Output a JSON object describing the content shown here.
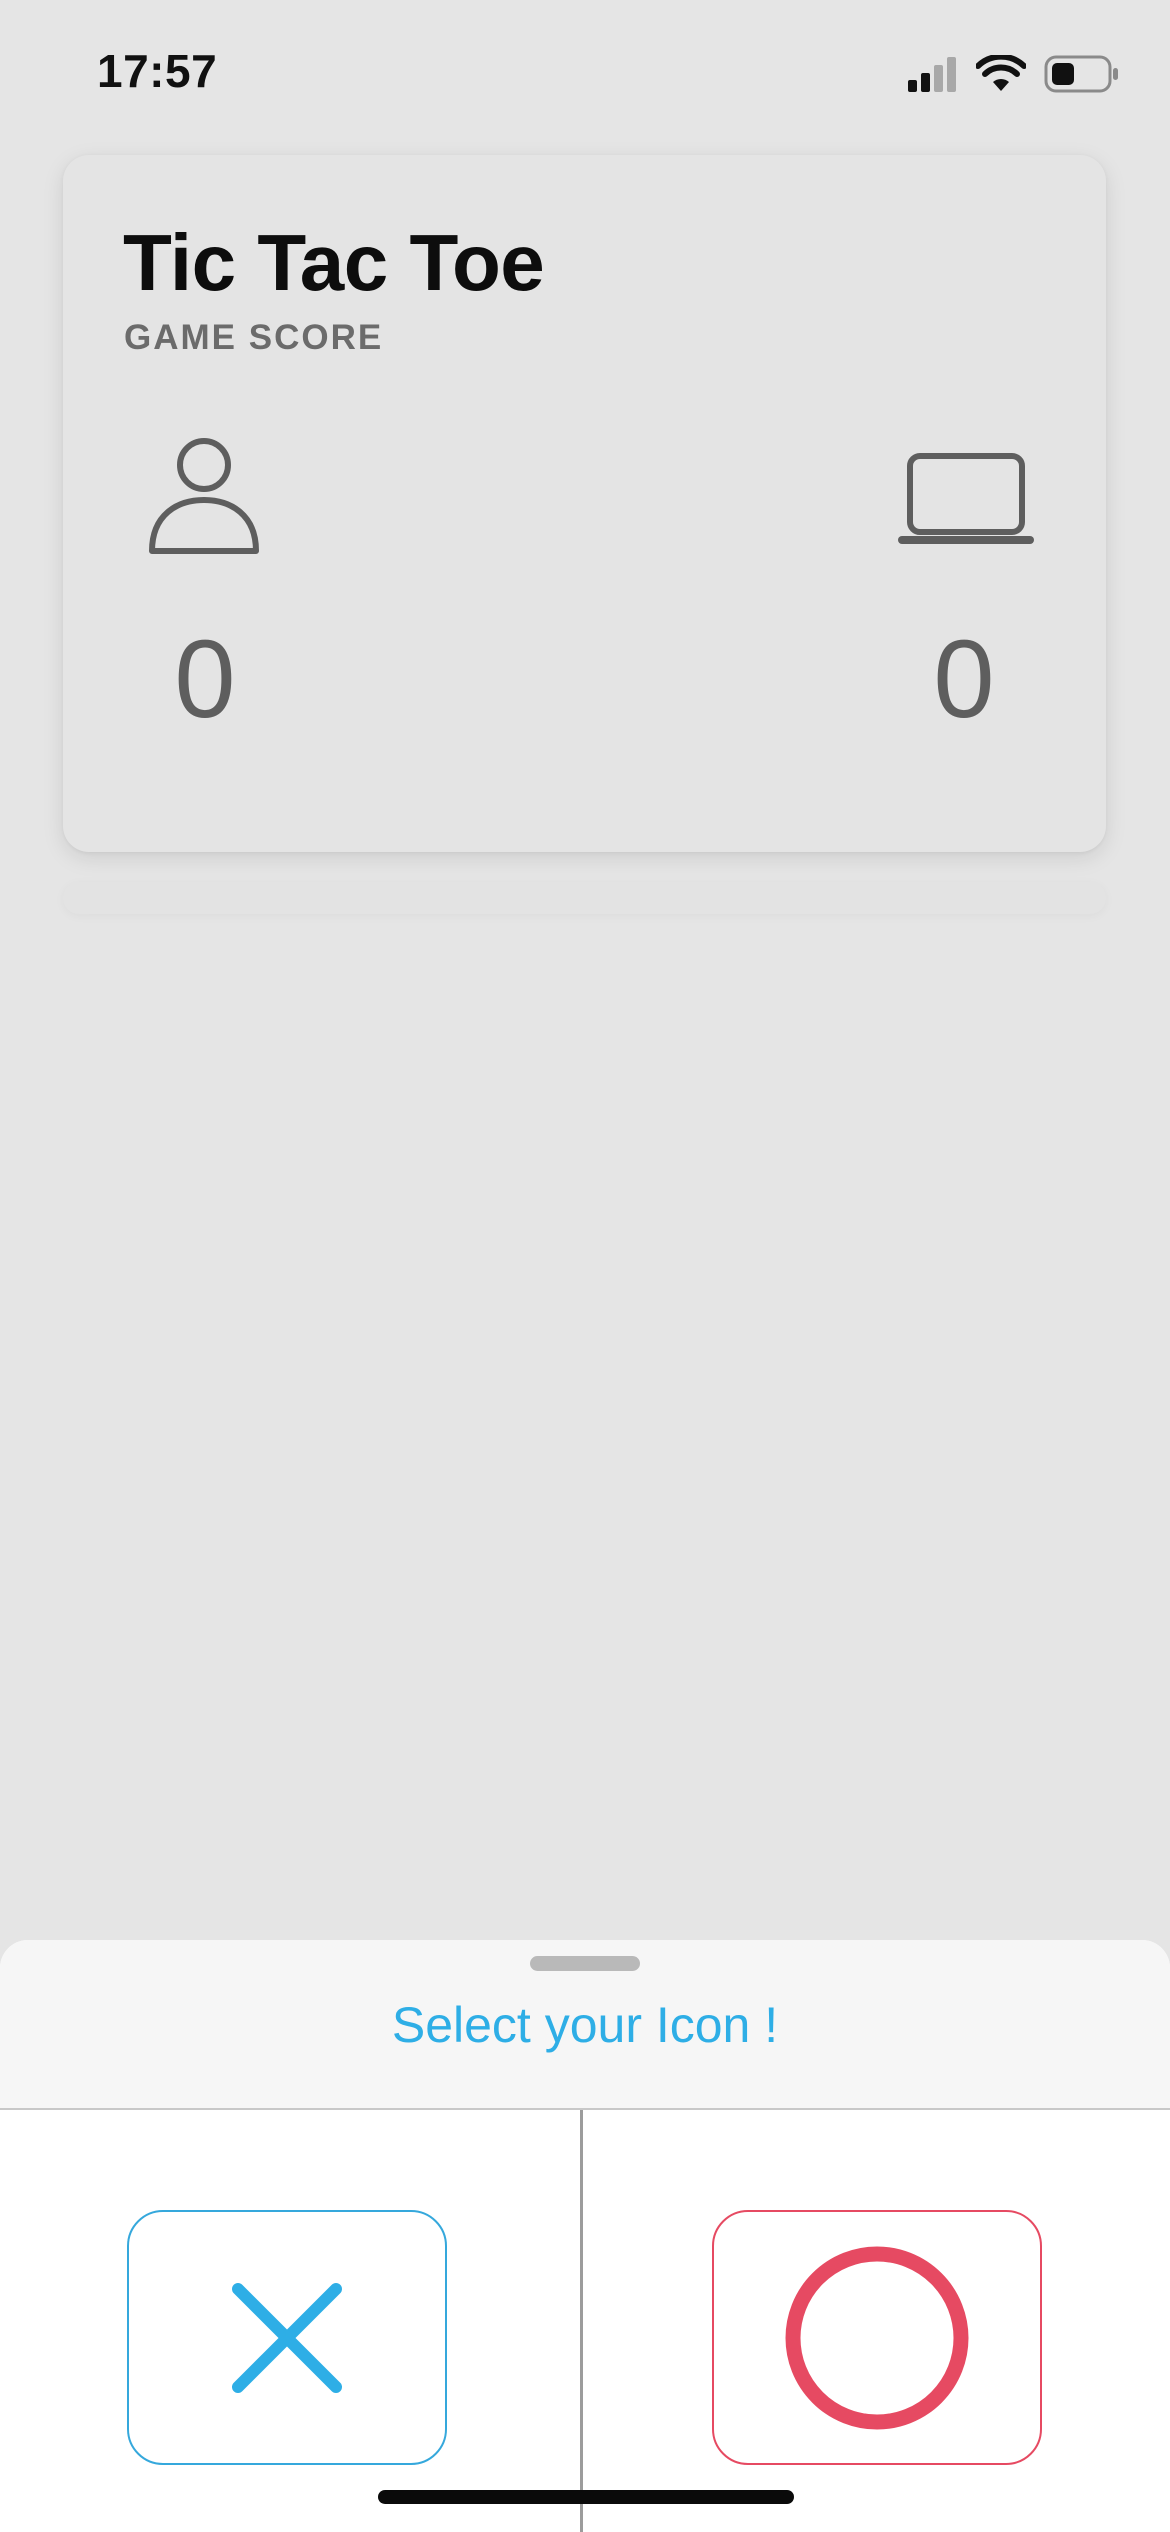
{
  "status_bar": {
    "time": "17:57",
    "icons": [
      "cellular-signal-icon",
      "wifi-icon",
      "battery-icon"
    ]
  },
  "score_card": {
    "title": "Tic Tac Toe",
    "subtitle": "GAME SCORE",
    "player": {
      "icon": "person-icon",
      "score": "0"
    },
    "computer": {
      "icon": "laptop-icon",
      "score": "0"
    }
  },
  "sheet": {
    "title": "Select your Icon !",
    "options": [
      {
        "icon": "x-icon",
        "color": "#2eaee6"
      },
      {
        "icon": "o-icon",
        "color": "#e64a62"
      }
    ]
  },
  "colors": {
    "background": "#e5e5e5",
    "accent_blue": "#2eaee6",
    "accent_red": "#e64a62",
    "score_gray": "#5e5e5e"
  }
}
